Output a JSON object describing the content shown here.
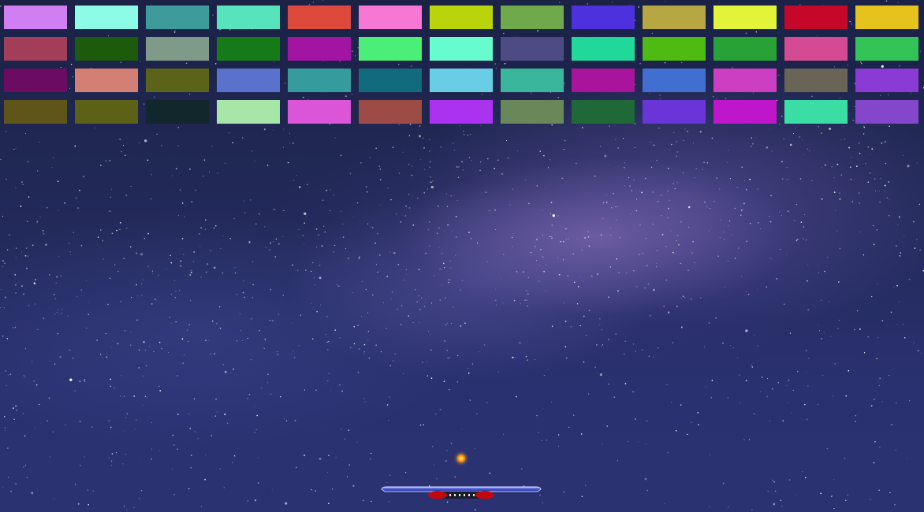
{
  "game": {
    "name": "brick-breaker",
    "brick_rows": [
      [
        "#d07ef2",
        "#8dfce6",
        "#3e9b9c",
        "#57e3bc",
        "#dd4a3b",
        "#f777d5",
        "#bad40c",
        "#70a94b",
        "#4d31dc",
        "#b7a742",
        "#e3f33a",
        "#c5072a",
        "#e6c21c"
      ],
      [
        "#a23e5a",
        "#1c5a0c",
        "#7f9a88",
        "#167a18",
        "#a214a2",
        "#4aef78",
        "#66fccd",
        "#4e4b84",
        "#1fd89a",
        "#4dbb12",
        "#28a236",
        "#d44b93",
        "#33c356"
      ],
      [
        "#6b0c62",
        "#d47f73",
        "#5b6318",
        "#5a72cc",
        "#359b9c",
        "#116b7c",
        "#6acde6",
        "#3ab69c",
        "#a8159c",
        "#416fcf",
        "#cd3fc2",
        "#686456",
        "#8a3ad5"
      ],
      [
        "#5f5518",
        "#5b6218",
        "#11272b",
        "#a7e5a8",
        "#da55d7",
        "#9d4c45",
        "#ab33ef",
        "#698758",
        "#1f6838",
        "#6935d9",
        "#bf16cc",
        "#3adea4",
        "#8446cb"
      ]
    ],
    "paddle": {
      "bar_color": "#2f3fb6",
      "cap_color": "#c4070c"
    },
    "ball": {
      "color": "#f6a126"
    }
  }
}
